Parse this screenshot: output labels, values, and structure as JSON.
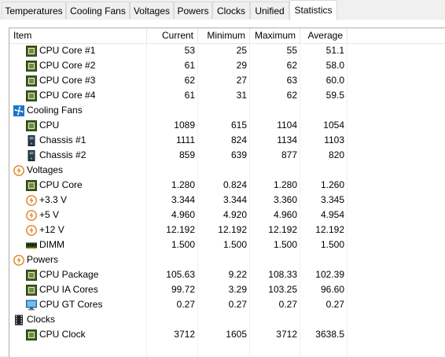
{
  "tabs": [
    {
      "label": "Temperatures",
      "active": false
    },
    {
      "label": "Cooling Fans",
      "active": false
    },
    {
      "label": "Voltages",
      "active": false
    },
    {
      "label": "Powers",
      "active": false
    },
    {
      "label": "Clocks",
      "active": false
    },
    {
      "label": "Unified",
      "active": false
    },
    {
      "label": "Statistics",
      "active": true
    }
  ],
  "columns": {
    "item": "Item",
    "current": "Current",
    "minimum": "Minimum",
    "maximum": "Maximum",
    "average": "Average"
  },
  "rows": [
    {
      "type": "item",
      "icon": "cpu-chip-icon",
      "name": "CPU Core #1",
      "current": "53",
      "minimum": "25",
      "maximum": "55",
      "average": "51.1"
    },
    {
      "type": "item",
      "icon": "cpu-chip-icon",
      "name": "CPU Core #2",
      "current": "61",
      "minimum": "29",
      "maximum": "62",
      "average": "58.0"
    },
    {
      "type": "item",
      "icon": "cpu-chip-icon",
      "name": "CPU Core #3",
      "current": "62",
      "minimum": "27",
      "maximum": "63",
      "average": "60.0"
    },
    {
      "type": "item",
      "icon": "cpu-chip-icon",
      "name": "CPU Core #4",
      "current": "61",
      "minimum": "31",
      "maximum": "62",
      "average": "59.5"
    },
    {
      "type": "group",
      "icon": "fan-icon",
      "name": "Cooling Fans"
    },
    {
      "type": "item",
      "icon": "cpu-chip-icon",
      "name": "CPU",
      "current": "1089",
      "minimum": "615",
      "maximum": "1104",
      "average": "1054"
    },
    {
      "type": "item",
      "icon": "chassis-icon",
      "name": "Chassis #1",
      "current": "1111",
      "minimum": "824",
      "maximum": "1134",
      "average": "1103"
    },
    {
      "type": "item",
      "icon": "chassis-icon",
      "name": "Chassis #2",
      "current": "859",
      "minimum": "639",
      "maximum": "877",
      "average": "820"
    },
    {
      "type": "group",
      "icon": "voltage-icon",
      "name": "Voltages"
    },
    {
      "type": "item",
      "icon": "cpu-chip-icon",
      "name": "CPU Core",
      "current": "1.280",
      "minimum": "0.824",
      "maximum": "1.280",
      "average": "1.260"
    },
    {
      "type": "item",
      "icon": "voltage-icon",
      "name": "+3.3 V",
      "current": "3.344",
      "minimum": "3.344",
      "maximum": "3.360",
      "average": "3.345"
    },
    {
      "type": "item",
      "icon": "voltage-icon",
      "name": "+5 V",
      "current": "4.960",
      "minimum": "4.920",
      "maximum": "4.960",
      "average": "4.954"
    },
    {
      "type": "item",
      "icon": "voltage-icon",
      "name": "+12 V",
      "current": "12.192",
      "minimum": "12.192",
      "maximum": "12.192",
      "average": "12.192"
    },
    {
      "type": "item",
      "icon": "dimm-icon",
      "name": "DIMM",
      "current": "1.500",
      "minimum": "1.500",
      "maximum": "1.500",
      "average": "1.500"
    },
    {
      "type": "group",
      "icon": "voltage-icon",
      "name": "Powers"
    },
    {
      "type": "item",
      "icon": "cpu-chip-icon",
      "name": "CPU Package",
      "current": "105.63",
      "minimum": "9.22",
      "maximum": "108.33",
      "average": "102.39"
    },
    {
      "type": "item",
      "icon": "cpu-chip-icon",
      "name": "CPU IA Cores",
      "current": "99.72",
      "minimum": "3.29",
      "maximum": "103.25",
      "average": "96.60"
    },
    {
      "type": "item",
      "icon": "monitor-icon",
      "name": "CPU GT Cores",
      "current": "0.27",
      "minimum": "0.27",
      "maximum": "0.27",
      "average": "0.27"
    },
    {
      "type": "group",
      "icon": "clock-film-icon",
      "name": "Clocks"
    },
    {
      "type": "item",
      "icon": "cpu-chip-icon",
      "name": "CPU Clock",
      "current": "3712",
      "minimum": "1605",
      "maximum": "3712",
      "average": "3638.5"
    }
  ]
}
